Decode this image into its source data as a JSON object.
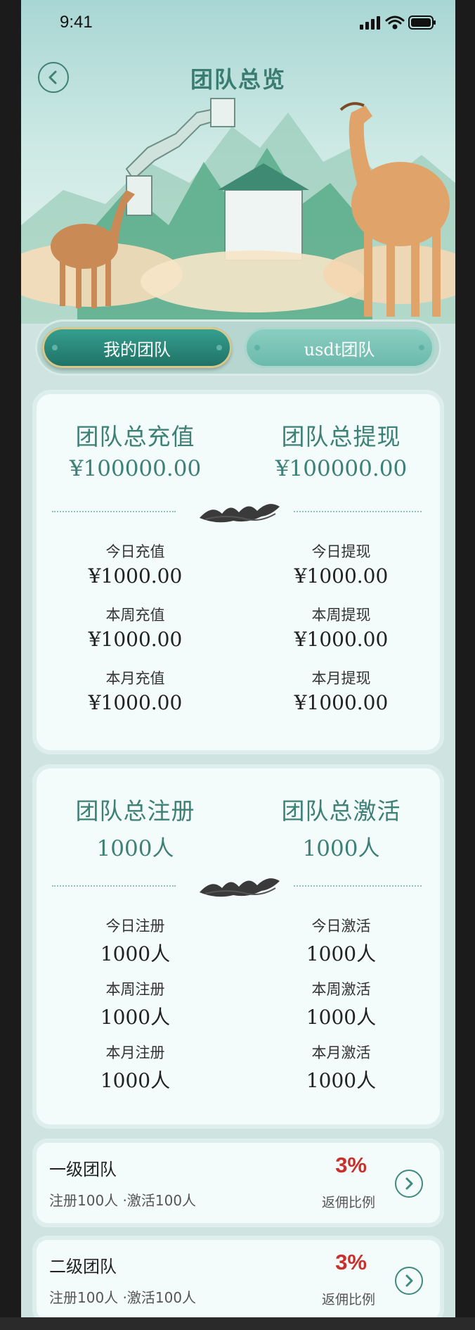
{
  "status": {
    "time": "9:41"
  },
  "header": {
    "title": "团队总览"
  },
  "tabs": [
    {
      "label": "我的团队",
      "active": true
    },
    {
      "label": "usdt团队",
      "active": false
    }
  ],
  "finance": {
    "total_recharge_label": "团队总充值",
    "total_recharge_value": "¥100000.00",
    "total_withdraw_label": "团队总提现",
    "total_withdraw_value": "¥100000.00",
    "rows": [
      {
        "left_label": "今日充值",
        "left_value": "¥1000.00",
        "right_label": "今日提现",
        "right_value": "¥1000.00"
      },
      {
        "left_label": "本周充值",
        "left_value": "¥1000.00",
        "right_label": "本周提现",
        "right_value": "¥1000.00"
      },
      {
        "left_label": "本月充值",
        "left_value": "¥1000.00",
        "right_label": "本月提现",
        "right_value": "¥1000.00"
      }
    ]
  },
  "members": {
    "total_register_label": "团队总注册",
    "total_register_value": "1000人",
    "total_active_label": "团队总激活",
    "total_active_value": "1000人",
    "rows": [
      {
        "left_label": "今日注册",
        "left_value": "1000人",
        "right_label": "今日激活",
        "right_value": "1000人"
      },
      {
        "left_label": "本周注册",
        "left_value": "1000人",
        "right_label": "本周激活",
        "right_value": "1000人"
      },
      {
        "left_label": "本月注册",
        "left_value": "1000人",
        "right_label": "本月激活",
        "right_value": "1000人"
      }
    ]
  },
  "teams": [
    {
      "name": "一级团队",
      "stats": "注册100人 ·激活100人",
      "percent": "3%",
      "percent_label": "返佣比例"
    },
    {
      "name": "二级团队",
      "stats": "注册100人 ·激活100人",
      "percent": "3%",
      "percent_label": "返佣比例"
    }
  ],
  "colors": {
    "accent": "#3d8076",
    "tab_active": "#1e7064",
    "percent": "#c9302c",
    "card_bg": "#f3fbfb"
  },
  "icons": {
    "back": "chevron-left-icon",
    "row_arrow": "chevron-right-icon"
  }
}
